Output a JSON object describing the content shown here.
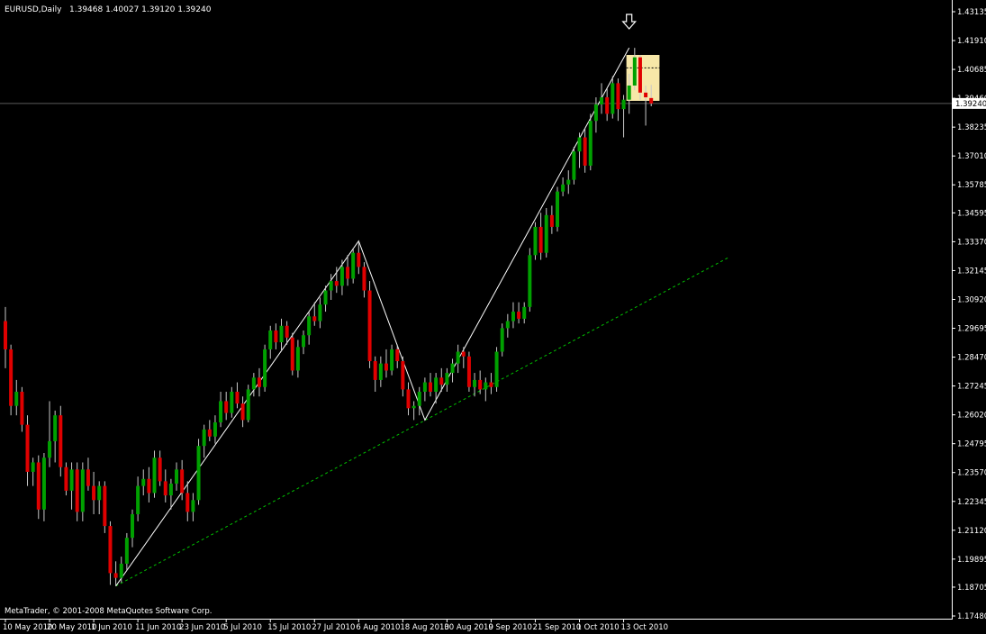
{
  "header": {
    "symbol": "EURUSD,Daily",
    "ohlc": "1.39468 1.40027 1.39120 1.39240"
  },
  "copyright": "MetaTrader, © 2001-2008 MetaQuotes Software Corp.",
  "colors": {
    "background": "#000000",
    "grid_and_axis": "#ffffff",
    "bull_candle": "#00a000",
    "bear_candle": "#e00000",
    "wick": "#c8c8c8",
    "zigzag": "#ffffff",
    "trendline": "#00c000",
    "highlight_box": "#f7e7a8"
  },
  "icons": {
    "marker": "down-arrow-icon"
  },
  "chart_data": {
    "type": "candlestick",
    "symbol": "EURUSD",
    "timeframe": "Daily",
    "y_ticks": [
      "1.43135",
      "1.41910",
      "1.40685",
      "1.39460",
      "1.38235",
      "1.37010",
      "1.35785",
      "1.34595",
      "1.33370",
      "1.32145",
      "1.30920",
      "1.29695",
      "1.28470",
      "1.27245",
      "1.26020",
      "1.24795",
      "1.23570",
      "1.22345",
      "1.21120",
      "1.19895",
      "1.18705",
      "1.17480"
    ],
    "y_range": [
      1.1748,
      1.43135
    ],
    "current_price_label": "1.39240",
    "x_ticks": [
      {
        "label": "10 May 2010",
        "bar": 0
      },
      {
        "label": "20 May 2010",
        "bar": 8
      },
      {
        "label": "1 Jun 2010",
        "bar": 16
      },
      {
        "label": "11 Jun 2010",
        "bar": 24
      },
      {
        "label": "23 Jun 2010",
        "bar": 32
      },
      {
        "label": "5 Jul 2010",
        "bar": 40
      },
      {
        "label": "15 Jul 2010",
        "bar": 48
      },
      {
        "label": "27 Jul 2010",
        "bar": 56
      },
      {
        "label": "6 Aug 2010",
        "bar": 64
      },
      {
        "label": "18 Aug 2010",
        "bar": 72
      },
      {
        "label": "30 Aug 2010",
        "bar": 80
      },
      {
        "label": "9 Sep 2010",
        "bar": 88
      },
      {
        "label": "21 Sep 2010",
        "bar": 96
      },
      {
        "label": "1 Oct 2010",
        "bar": 104
      },
      {
        "label": "13 Oct 2010",
        "bar": 112
      }
    ],
    "zigzag_points": [
      {
        "bar": 20,
        "price": 1.1875
      },
      {
        "bar": 64,
        "price": 1.334
      },
      {
        "bar": 76,
        "price": 1.258
      },
      {
        "bar": 113,
        "price": 1.416
      }
    ],
    "trendline": {
      "from": {
        "bar": 20,
        "price": 1.1875
      },
      "to": {
        "bar": 131,
        "price": 1.327
      }
    },
    "highlight_zone": {
      "bar_start": 112.5,
      "bar_end": 118.5,
      "price_low": 1.3935,
      "price_high": 1.413,
      "mid": 1.4075
    },
    "marker_bar": 113,
    "candles": [
      {
        "o": 1.3,
        "h": 1.306,
        "l": 1.28,
        "c": 1.288
      },
      {
        "o": 1.288,
        "h": 1.29,
        "l": 1.26,
        "c": 1.264
      },
      {
        "o": 1.264,
        "h": 1.275,
        "l": 1.26,
        "c": 1.27
      },
      {
        "o": 1.27,
        "h": 1.272,
        "l": 1.253,
        "c": 1.256
      },
      {
        "o": 1.256,
        "h": 1.26,
        "l": 1.23,
        "c": 1.236
      },
      {
        "o": 1.236,
        "h": 1.242,
        "l": 1.23,
        "c": 1.24
      },
      {
        "o": 1.24,
        "h": 1.243,
        "l": 1.216,
        "c": 1.22
      },
      {
        "o": 1.22,
        "h": 1.244,
        "l": 1.215,
        "c": 1.242
      },
      {
        "o": 1.242,
        "h": 1.266,
        "l": 1.238,
        "c": 1.249
      },
      {
        "o": 1.249,
        "h": 1.262,
        "l": 1.24,
        "c": 1.26
      },
      {
        "o": 1.26,
        "h": 1.264,
        "l": 1.234,
        "c": 1.238
      },
      {
        "o": 1.238,
        "h": 1.24,
        "l": 1.226,
        "c": 1.228
      },
      {
        "o": 1.228,
        "h": 1.24,
        "l": 1.22,
        "c": 1.237
      },
      {
        "o": 1.237,
        "h": 1.24,
        "l": 1.215,
        "c": 1.219
      },
      {
        "o": 1.219,
        "h": 1.24,
        "l": 1.215,
        "c": 1.237
      },
      {
        "o": 1.237,
        "h": 1.242,
        "l": 1.228,
        "c": 1.23
      },
      {
        "o": 1.23,
        "h": 1.236,
        "l": 1.218,
        "c": 1.224
      },
      {
        "o": 1.224,
        "h": 1.232,
        "l": 1.218,
        "c": 1.23
      },
      {
        "o": 1.23,
        "h": 1.232,
        "l": 1.21,
        "c": 1.213
      },
      {
        "o": 1.213,
        "h": 1.215,
        "l": 1.188,
        "c": 1.193
      },
      {
        "o": 1.193,
        "h": 1.198,
        "l": 1.1875,
        "c": 1.191
      },
      {
        "o": 1.191,
        "h": 1.2,
        "l": 1.189,
        "c": 1.197
      },
      {
        "o": 1.197,
        "h": 1.21,
        "l": 1.194,
        "c": 1.208
      },
      {
        "o": 1.208,
        "h": 1.22,
        "l": 1.204,
        "c": 1.218
      },
      {
        "o": 1.218,
        "h": 1.234,
        "l": 1.215,
        "c": 1.23
      },
      {
        "o": 1.23,
        "h": 1.237,
        "l": 1.226,
        "c": 1.233
      },
      {
        "o": 1.233,
        "h": 1.238,
        "l": 1.223,
        "c": 1.227
      },
      {
        "o": 1.227,
        "h": 1.245,
        "l": 1.225,
        "c": 1.242
      },
      {
        "o": 1.242,
        "h": 1.245,
        "l": 1.23,
        "c": 1.232
      },
      {
        "o": 1.232,
        "h": 1.237,
        "l": 1.223,
        "c": 1.226
      },
      {
        "o": 1.226,
        "h": 1.233,
        "l": 1.22,
        "c": 1.231
      },
      {
        "o": 1.231,
        "h": 1.24,
        "l": 1.228,
        "c": 1.237
      },
      {
        "o": 1.237,
        "h": 1.241,
        "l": 1.224,
        "c": 1.227
      },
      {
        "o": 1.227,
        "h": 1.232,
        "l": 1.215,
        "c": 1.219
      },
      {
        "o": 1.219,
        "h": 1.227,
        "l": 1.215,
        "c": 1.224
      },
      {
        "o": 1.224,
        "h": 1.25,
        "l": 1.222,
        "c": 1.247
      },
      {
        "o": 1.247,
        "h": 1.256,
        "l": 1.242,
        "c": 1.254
      },
      {
        "o": 1.254,
        "h": 1.258,
        "l": 1.249,
        "c": 1.251
      },
      {
        "o": 1.251,
        "h": 1.26,
        "l": 1.248,
        "c": 1.257
      },
      {
        "o": 1.257,
        "h": 1.27,
        "l": 1.255,
        "c": 1.266
      },
      {
        "o": 1.266,
        "h": 1.27,
        "l": 1.258,
        "c": 1.261
      },
      {
        "o": 1.261,
        "h": 1.272,
        "l": 1.259,
        "c": 1.27
      },
      {
        "o": 1.27,
        "h": 1.274,
        "l": 1.263,
        "c": 1.265
      },
      {
        "o": 1.265,
        "h": 1.268,
        "l": 1.255,
        "c": 1.258
      },
      {
        "o": 1.258,
        "h": 1.273,
        "l": 1.257,
        "c": 1.271
      },
      {
        "o": 1.271,
        "h": 1.278,
        "l": 1.268,
        "c": 1.276
      },
      {
        "o": 1.276,
        "h": 1.28,
        "l": 1.268,
        "c": 1.272
      },
      {
        "o": 1.272,
        "h": 1.29,
        "l": 1.27,
        "c": 1.288
      },
      {
        "o": 1.288,
        "h": 1.298,
        "l": 1.284,
        "c": 1.296
      },
      {
        "o": 1.296,
        "h": 1.299,
        "l": 1.288,
        "c": 1.291
      },
      {
        "o": 1.291,
        "h": 1.301,
        "l": 1.287,
        "c": 1.298
      },
      {
        "o": 1.298,
        "h": 1.3,
        "l": 1.29,
        "c": 1.293
      },
      {
        "o": 1.293,
        "h": 1.295,
        "l": 1.277,
        "c": 1.279
      },
      {
        "o": 1.279,
        "h": 1.292,
        "l": 1.276,
        "c": 1.289
      },
      {
        "o": 1.289,
        "h": 1.296,
        "l": 1.286,
        "c": 1.294
      },
      {
        "o": 1.294,
        "h": 1.304,
        "l": 1.29,
        "c": 1.302
      },
      {
        "o": 1.302,
        "h": 1.308,
        "l": 1.298,
        "c": 1.3
      },
      {
        "o": 1.3,
        "h": 1.31,
        "l": 1.297,
        "c": 1.307
      },
      {
        "o": 1.307,
        "h": 1.315,
        "l": 1.304,
        "c": 1.313
      },
      {
        "o": 1.313,
        "h": 1.32,
        "l": 1.309,
        "c": 1.317
      },
      {
        "o": 1.317,
        "h": 1.323,
        "l": 1.312,
        "c": 1.315
      },
      {
        "o": 1.315,
        "h": 1.326,
        "l": 1.311,
        "c": 1.323
      },
      {
        "o": 1.323,
        "h": 1.328,
        "l": 1.315,
        "c": 1.318
      },
      {
        "o": 1.318,
        "h": 1.331,
        "l": 1.316,
        "c": 1.329
      },
      {
        "o": 1.329,
        "h": 1.334,
        "l": 1.32,
        "c": 1.323
      },
      {
        "o": 1.323,
        "h": 1.325,
        "l": 1.31,
        "c": 1.313
      },
      {
        "o": 1.313,
        "h": 1.317,
        "l": 1.28,
        "c": 1.283
      },
      {
        "o": 1.283,
        "h": 1.285,
        "l": 1.27,
        "c": 1.275
      },
      {
        "o": 1.275,
        "h": 1.285,
        "l": 1.272,
        "c": 1.282
      },
      {
        "o": 1.282,
        "h": 1.288,
        "l": 1.276,
        "c": 1.279
      },
      {
        "o": 1.279,
        "h": 1.29,
        "l": 1.277,
        "c": 1.288
      },
      {
        "o": 1.288,
        "h": 1.29,
        "l": 1.28,
        "c": 1.283
      },
      {
        "o": 1.283,
        "h": 1.285,
        "l": 1.268,
        "c": 1.271
      },
      {
        "o": 1.271,
        "h": 1.274,
        "l": 1.26,
        "c": 1.263
      },
      {
        "o": 1.263,
        "h": 1.266,
        "l": 1.258,
        "c": 1.264
      },
      {
        "o": 1.264,
        "h": 1.272,
        "l": 1.26,
        "c": 1.27
      },
      {
        "o": 1.27,
        "h": 1.276,
        "l": 1.266,
        "c": 1.274
      },
      {
        "o": 1.274,
        "h": 1.278,
        "l": 1.268,
        "c": 1.27
      },
      {
        "o": 1.27,
        "h": 1.278,
        "l": 1.265,
        "c": 1.276
      },
      {
        "o": 1.276,
        "h": 1.28,
        "l": 1.27,
        "c": 1.273
      },
      {
        "o": 1.273,
        "h": 1.28,
        "l": 1.27,
        "c": 1.278
      },
      {
        "o": 1.278,
        "h": 1.284,
        "l": 1.274,
        "c": 1.282
      },
      {
        "o": 1.282,
        "h": 1.29,
        "l": 1.278,
        "c": 1.287
      },
      {
        "o": 1.287,
        "h": 1.289,
        "l": 1.28,
        "c": 1.285
      },
      {
        "o": 1.285,
        "h": 1.287,
        "l": 1.27,
        "c": 1.272
      },
      {
        "o": 1.272,
        "h": 1.278,
        "l": 1.268,
        "c": 1.275
      },
      {
        "o": 1.275,
        "h": 1.279,
        "l": 1.269,
        "c": 1.271
      },
      {
        "o": 1.271,
        "h": 1.276,
        "l": 1.266,
        "c": 1.274
      },
      {
        "o": 1.274,
        "h": 1.278,
        "l": 1.269,
        "c": 1.272
      },
      {
        "o": 1.272,
        "h": 1.289,
        "l": 1.27,
        "c": 1.287
      },
      {
        "o": 1.287,
        "h": 1.299,
        "l": 1.285,
        "c": 1.297
      },
      {
        "o": 1.297,
        "h": 1.303,
        "l": 1.293,
        "c": 1.3
      },
      {
        "o": 1.3,
        "h": 1.308,
        "l": 1.297,
        "c": 1.304
      },
      {
        "o": 1.304,
        "h": 1.308,
        "l": 1.299,
        "c": 1.301
      },
      {
        "o": 1.301,
        "h": 1.308,
        "l": 1.299,
        "c": 1.306
      },
      {
        "o": 1.306,
        "h": 1.331,
        "l": 1.304,
        "c": 1.328
      },
      {
        "o": 1.328,
        "h": 1.342,
        "l": 1.326,
        "c": 1.34
      },
      {
        "o": 1.34,
        "h": 1.346,
        "l": 1.326,
        "c": 1.329
      },
      {
        "o": 1.329,
        "h": 1.348,
        "l": 1.327,
        "c": 1.345
      },
      {
        "o": 1.345,
        "h": 1.349,
        "l": 1.337,
        "c": 1.34
      },
      {
        "o": 1.34,
        "h": 1.357,
        "l": 1.338,
        "c": 1.355
      },
      {
        "o": 1.355,
        "h": 1.361,
        "l": 1.353,
        "c": 1.358
      },
      {
        "o": 1.358,
        "h": 1.364,
        "l": 1.354,
        "c": 1.36
      },
      {
        "o": 1.36,
        "h": 1.374,
        "l": 1.358,
        "c": 1.372
      },
      {
        "o": 1.372,
        "h": 1.38,
        "l": 1.365,
        "c": 1.378
      },
      {
        "o": 1.378,
        "h": 1.382,
        "l": 1.363,
        "c": 1.366
      },
      {
        "o": 1.366,
        "h": 1.388,
        "l": 1.364,
        "c": 1.385
      },
      {
        "o": 1.385,
        "h": 1.395,
        "l": 1.38,
        "c": 1.392
      },
      {
        "o": 1.392,
        "h": 1.401,
        "l": 1.388,
        "c": 1.395
      },
      {
        "o": 1.395,
        "h": 1.399,
        "l": 1.385,
        "c": 1.388
      },
      {
        "o": 1.388,
        "h": 1.404,
        "l": 1.386,
        "c": 1.401
      },
      {
        "o": 1.401,
        "h": 1.403,
        "l": 1.385,
        "c": 1.39
      },
      {
        "o": 1.39,
        "h": 1.396,
        "l": 1.378,
        "c": 1.394
      },
      {
        "o": 1.394,
        "h": 1.405,
        "l": 1.388,
        "c": 1.4
      },
      {
        "o": 1.4,
        "h": 1.416,
        "l": 1.398,
        "c": 1.412
      },
      {
        "o": 1.412,
        "h": 1.413,
        "l": 1.394,
        "c": 1.397
      },
      {
        "o": 1.397,
        "h": 1.4,
        "l": 1.383,
        "c": 1.395
      },
      {
        "o": 1.3947,
        "h": 1.4003,
        "l": 1.3912,
        "c": 1.3924
      }
    ]
  }
}
